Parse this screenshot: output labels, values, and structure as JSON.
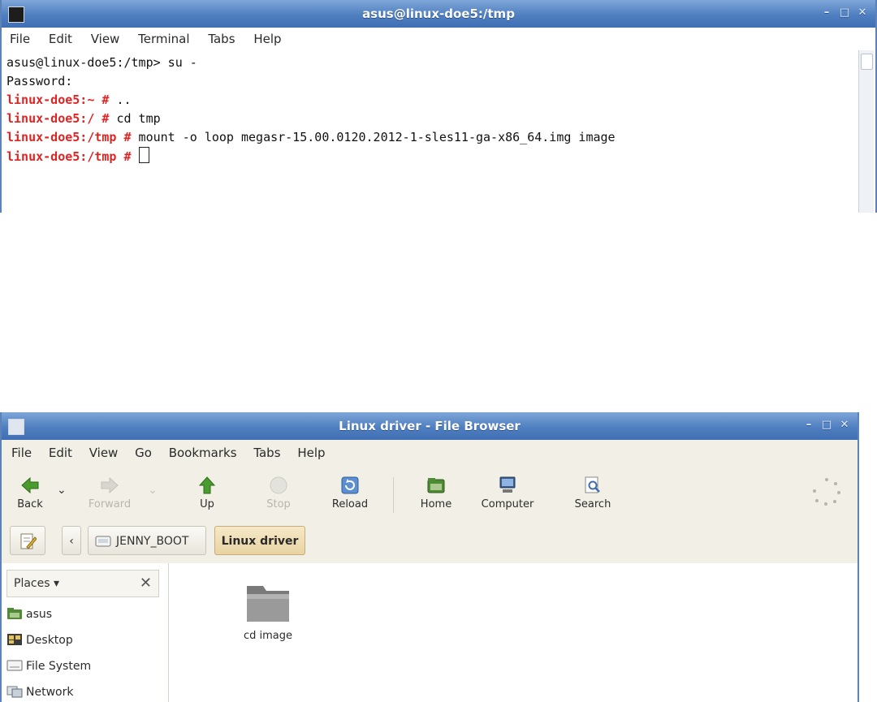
{
  "terminal": {
    "title": "asus@linux-doe5:/tmp",
    "menu": [
      "File",
      "Edit",
      "View",
      "Terminal",
      "Tabs",
      "Help"
    ],
    "lines": [
      {
        "prompt": "",
        "text": "asus@linux-doe5:/tmp> su -"
      },
      {
        "prompt": "",
        "text": "Password:"
      },
      {
        "prompt": "linux-doe5:~ #",
        "text": " .."
      },
      {
        "prompt": "linux-doe5:/ #",
        "text": " cd tmp"
      },
      {
        "prompt": "linux-doe5:/tmp #",
        "text": " mount -o loop megasr-15.00.0120.2012-1-sles11-ga-x86_64.img image"
      },
      {
        "prompt": "linux-doe5:/tmp #",
        "text": " "
      }
    ]
  },
  "browser": {
    "title": "Linux driver - File Browser",
    "menu": [
      "File",
      "Edit",
      "View",
      "Go",
      "Bookmarks",
      "Tabs",
      "Help"
    ],
    "toolbar": {
      "back": "Back",
      "forward": "Forward",
      "up": "Up",
      "stop": "Stop",
      "reload": "Reload",
      "home": "Home",
      "computer": "Computer",
      "search": "Search"
    },
    "path": {
      "toggle": "‹",
      "crumb1": "JENNY_BOOT",
      "crumb2": "Linux driver"
    },
    "side": {
      "header": "Places ▾",
      "close": "✕",
      "places": [
        "asus",
        "Desktop",
        "File System",
        "Network"
      ]
    },
    "files": [
      {
        "name": "cd image"
      }
    ],
    "colors": {
      "accent": "#4f7fc0",
      "prompt": "#e02424"
    }
  }
}
